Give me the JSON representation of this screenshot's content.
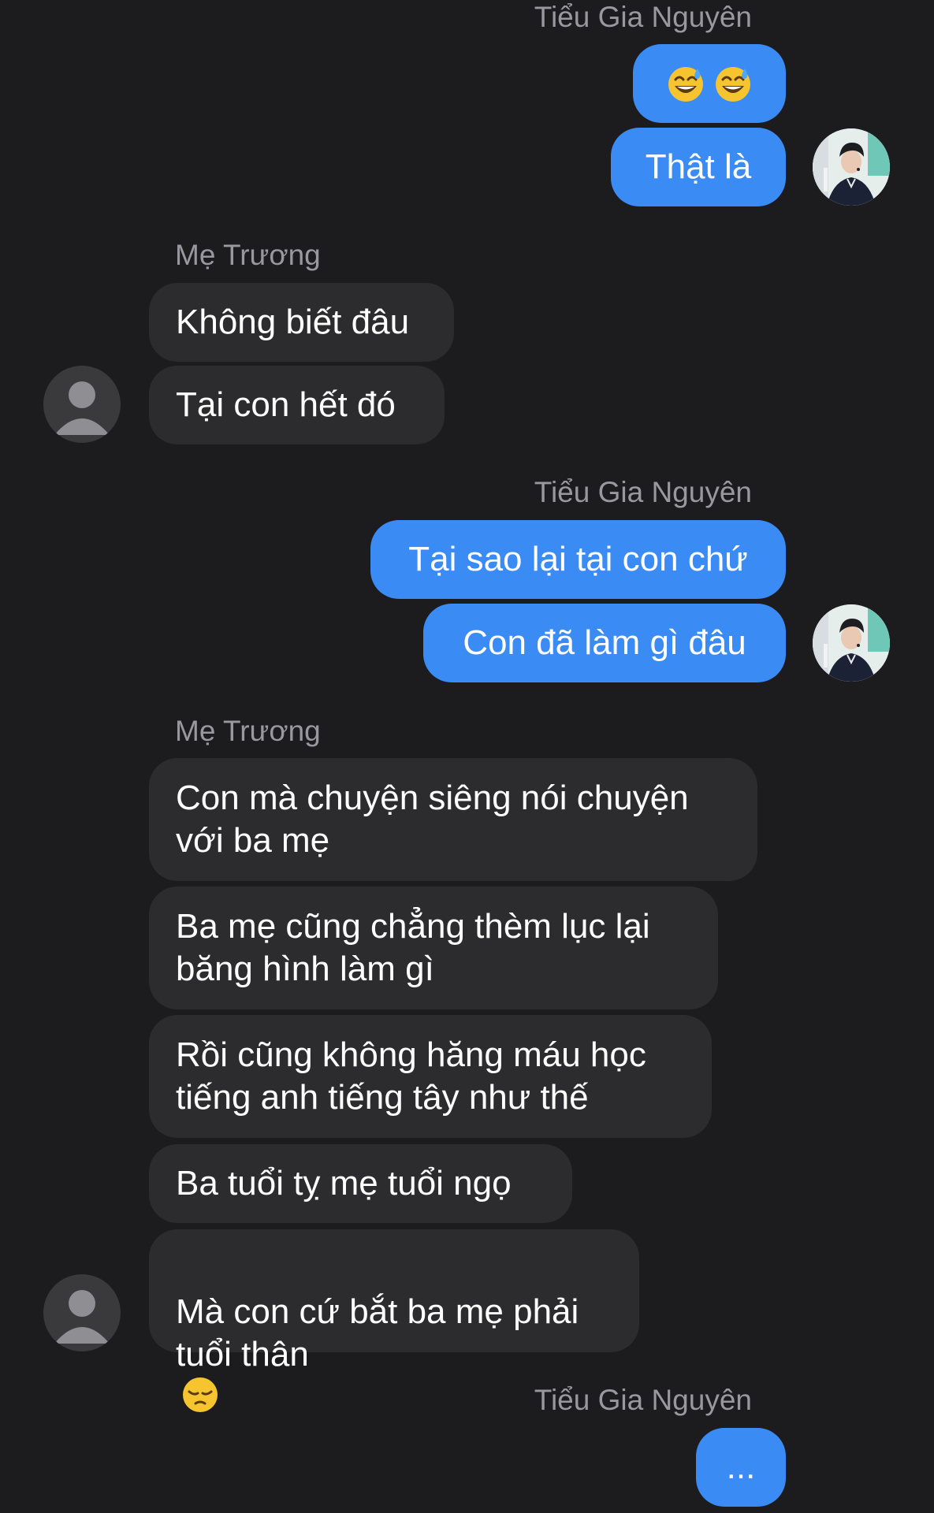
{
  "contact": {
    "mother_name": "Mẹ Trương",
    "self_name": "Tiểu Gia Nguyên"
  },
  "colors": {
    "background": "#1c1c1e",
    "outgoing_bubble": "#3b8bf5",
    "incoming_bubble": "#2c2c2e",
    "sender_label": "#98989d"
  },
  "groups": {
    "g1": {
      "sender": "Tiểu Gia Nguyên",
      "messages": [
        {
          "emoji": [
            "grinning-sweat-emoji",
            "grinning-sweat-emoji"
          ]
        },
        {
          "text": "Thật là"
        }
      ]
    },
    "g2": {
      "sender": "Mẹ Trương",
      "messages": [
        {
          "text": "Không biết đâu"
        },
        {
          "text": "Tại con hết đó"
        }
      ]
    },
    "g3": {
      "sender": "Tiểu Gia Nguyên",
      "messages": [
        {
          "text": "Tại sao lại tại con chứ"
        },
        {
          "text": "Con đã làm gì đâu"
        }
      ]
    },
    "g4": {
      "sender": "Mẹ Trương",
      "messages": [
        {
          "text": "Con mà chuyện siêng nói chuyện\nvới ba mẹ"
        },
        {
          "text": "Ba mẹ cũng chẳng thèm lục lại\nbăng hình làm gì"
        },
        {
          "text": "Rồi cũng không hăng máu học\ntiếng anh tiếng tây như thế"
        },
        {
          "text": "Ba tuổi tỵ mẹ tuổi ngọ"
        },
        {
          "text": "Mà con cứ bắt ba mẹ phải\ntuổi thân",
          "emoji": "pensive-face-emoji"
        }
      ]
    },
    "g5": {
      "sender": "Tiểu Gia Nguyên",
      "messages": [
        {
          "text": "..."
        }
      ]
    }
  }
}
